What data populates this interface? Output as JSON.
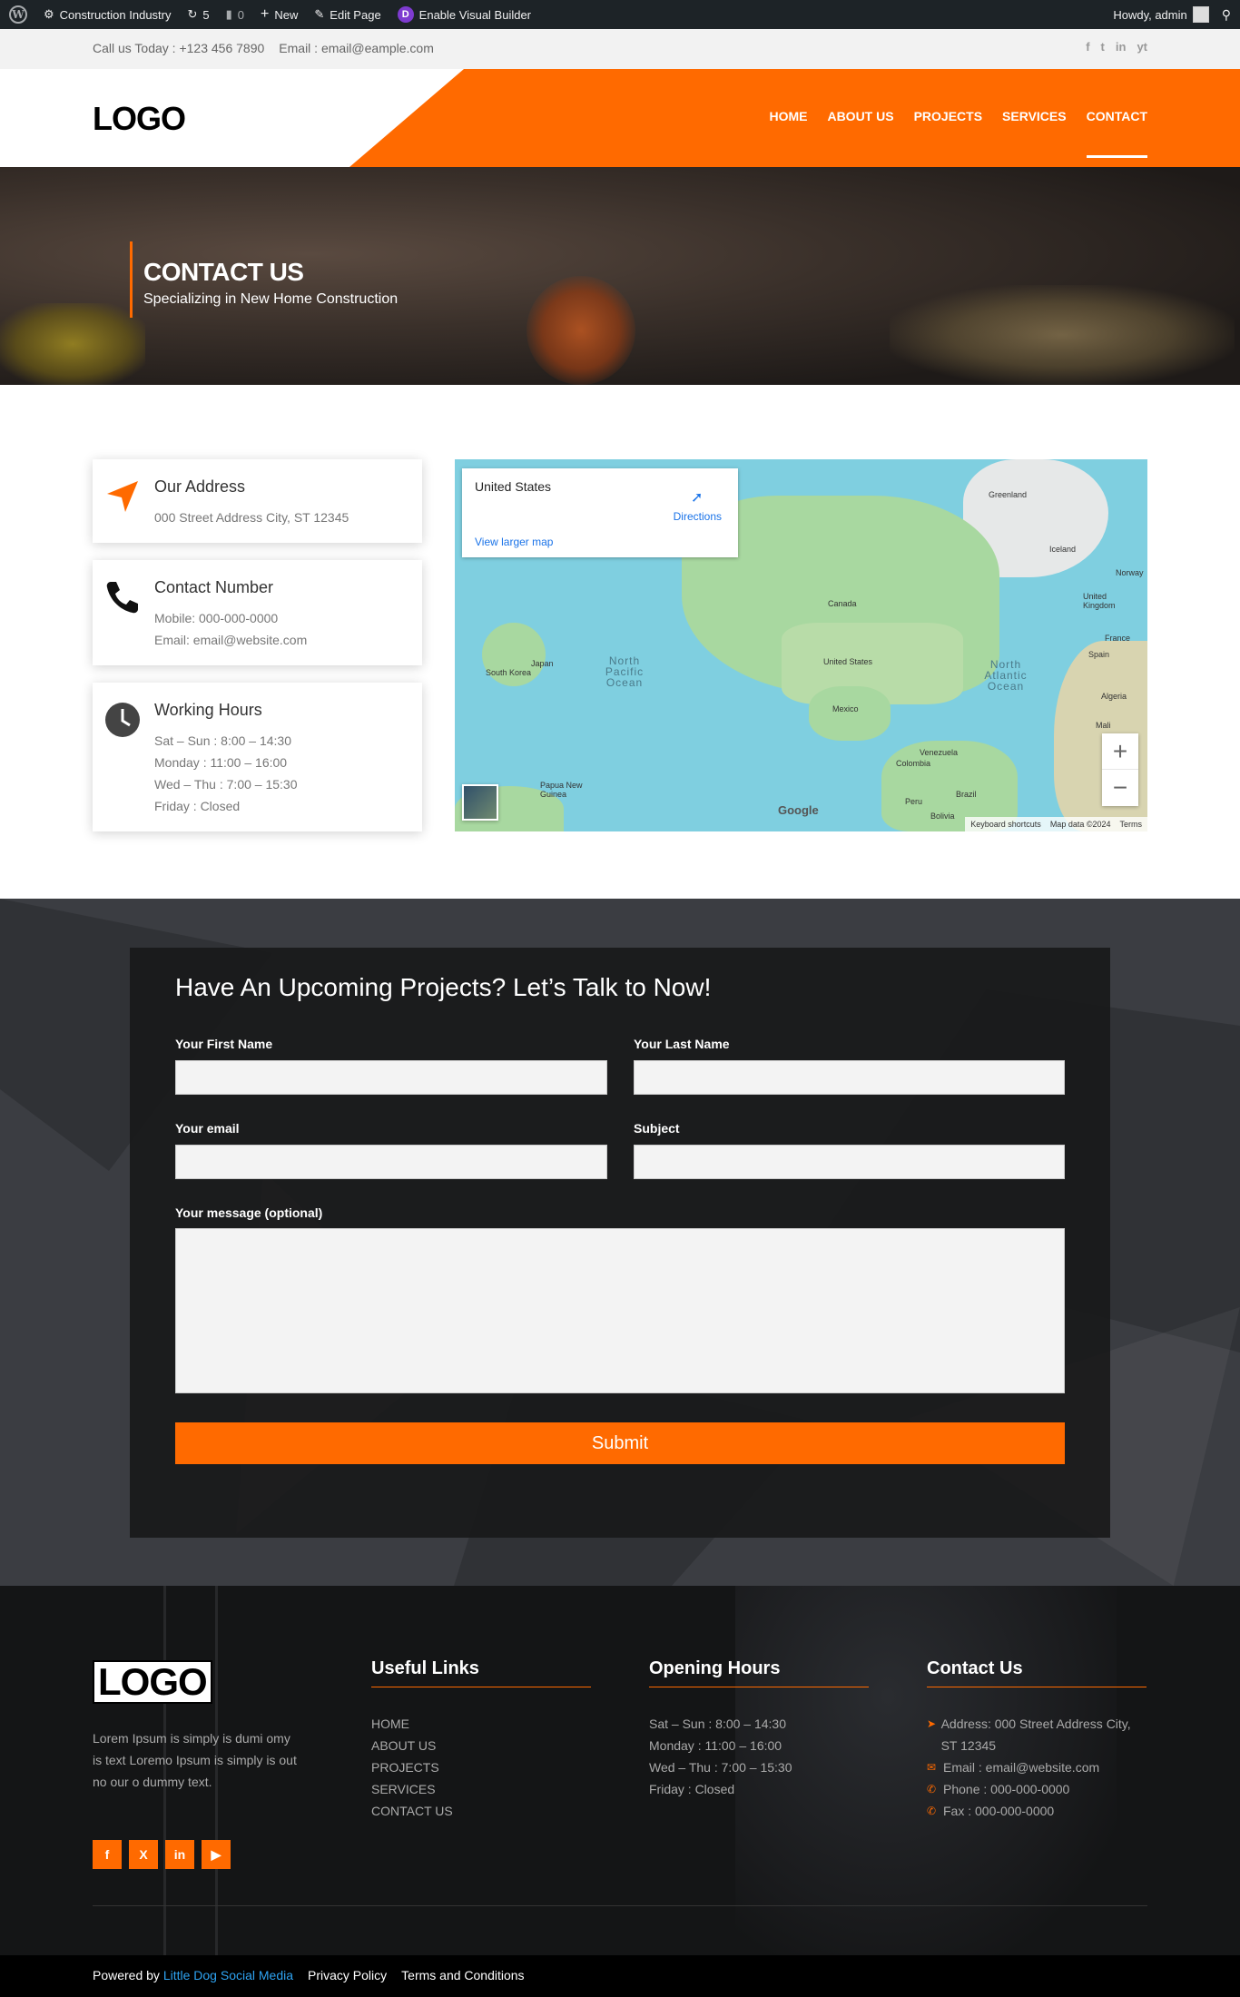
{
  "admin_bar": {
    "site_name": "Construction Industry",
    "updates_count": "5",
    "comments_count": "0",
    "new_label": "New",
    "edit_page_label": "Edit Page",
    "visual_builder_label": "Enable Visual Builder",
    "greeting": "Howdy, admin"
  },
  "topbar": {
    "phone": "Call us Today : +123 456 7890",
    "email": "Email : email@eample.com",
    "social": [
      "f",
      "t",
      "in",
      "yt"
    ]
  },
  "header": {
    "logo": "LOGO",
    "nav": [
      {
        "label": "HOME"
      },
      {
        "label": "ABOUT US"
      },
      {
        "label": "PROJECTS"
      },
      {
        "label": "SERVICES"
      },
      {
        "label": "CONTACT",
        "active": true
      }
    ],
    "accent_color": "#ff6a00"
  },
  "hero": {
    "title": "CONTACT US",
    "subtitle": "Specializing in New Home Construction"
  },
  "cards": [
    {
      "title": "Our Address",
      "lines": [
        "000 Street Address City, ST 12345"
      ],
      "icon": "location-arrow-icon"
    },
    {
      "title": "Contact Number",
      "lines": [
        "Mobile: 000-000-0000",
        "Email: email@website.com"
      ],
      "icon": "phone-icon"
    },
    {
      "title": "Working Hours",
      "lines": [
        "Sat – Sun : 8:00 – 14:30",
        "Monday : 11:00 – 16:00",
        "Wed – Thu : 7:00 – 15:30",
        "Friday : Closed"
      ],
      "icon": "clock-icon"
    }
  ],
  "map": {
    "place_title": "United States",
    "directions_label": "Directions",
    "view_larger_label": "View larger map",
    "labels": {
      "greenland": "Greenland",
      "iceland": "Iceland",
      "canada": "Canada",
      "us": "United States",
      "mexico": "Mexico",
      "venezuela": "Venezuela",
      "colombia": "Colombia",
      "peru": "Peru",
      "brazil": "Brazil",
      "bolivia": "Bolivia",
      "japan": "Japan",
      "south_korea": "South Korea",
      "png": "Papua New Guinea",
      "norway": "Norway",
      "uk": "United Kingdom",
      "france": "France",
      "spain": "Spain",
      "algeria": "Algeria",
      "mali": "Mali",
      "north_pacific": "North Pacific Ocean",
      "north_atlantic": "North Atlantic Ocean"
    },
    "google": "Google",
    "keyboard_shortcuts": "Keyboard shortcuts",
    "map_data": "Map data ©2024",
    "terms": "Terms"
  },
  "form": {
    "heading": "Have An Upcoming Projects? Let’s Talk to Now!",
    "first_name_label": "Your First Name",
    "last_name_label": "Your Last Name",
    "email_label": "Your email",
    "subject_label": "Subject",
    "message_label": "Your message (optional)",
    "submit_label": "Submit"
  },
  "footer": {
    "logo": "LOGO",
    "about": "Lorem Ipsum is simply is dumi omy is text Loremo Ipsum is simply is out no our o dummy text.",
    "socials": [
      "f",
      "X",
      "in",
      "▶"
    ],
    "useful_links": {
      "title": "Useful Links",
      "items": [
        "HOME",
        "ABOUT US",
        "PROJECTS",
        "SERVICES",
        "CONTACT US"
      ]
    },
    "opening_hours": {
      "title": "Opening Hours",
      "items": [
        "Sat – Sun : 8:00 – 14:30",
        "Monday : 11:00 – 16:00",
        "Wed – Thu : 7:00 – 15:30",
        "Friday : Closed"
      ]
    },
    "contact": {
      "title": "Contact Us",
      "address": "Address: 000 Street Address City, ST 12345",
      "email": "Email : email@website.com",
      "phone": "Phone : 000-000-0000",
      "fax": "Fax : 000-000-0000"
    }
  },
  "bottom": {
    "powered_by": "Powered by",
    "powered_link": "Little Dog Social Media",
    "privacy": "Privacy Policy",
    "terms": "Terms and Conditions"
  }
}
